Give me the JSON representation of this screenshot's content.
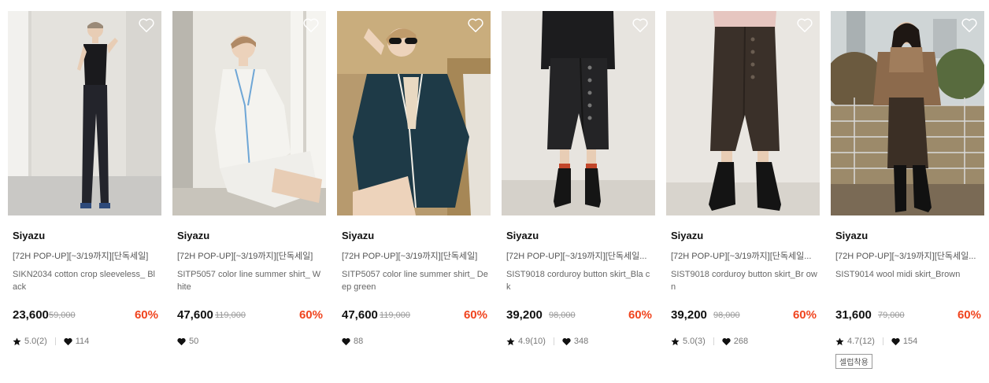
{
  "products": [
    {
      "brand": "Siyazu",
      "tagline": "[72H POP-UP][~3/19까지][단독세일]",
      "name": "SIKN2034 cotton crop sleeveless_ Black",
      "price": "23,600",
      "original_price": "59,000",
      "discount": "60%",
      "rating": "5.0(2)",
      "likes": "114",
      "photo_scene": "woman in black sleeveless top and trousers against white wall"
    },
    {
      "brand": "Siyazu",
      "tagline": "[72H POP-UP][~3/19까지][단독세일]",
      "name": "SITP5057 color line summer shirt_ White",
      "price": "47,600",
      "original_price": "119,000",
      "discount": "60%",
      "rating": "",
      "likes": "50",
      "photo_scene": "woman in white piped shirt seated by window"
    },
    {
      "brand": "Siyazu",
      "tagline": "[72H POP-UP][~3/19까지][단독세일]",
      "name": "SITP5057 color line summer shirt_ Deep green",
      "price": "47,600",
      "original_price": "119,000",
      "discount": "60%",
      "rating": "",
      "likes": "88",
      "photo_scene": "woman in deep green piped shirt with sunglasses outdoors"
    },
    {
      "brand": "Siyazu",
      "tagline": "[72H POP-UP][~3/19까지][단독세일...",
      "name": "SIST9018 corduroy button skirt_Bla ck",
      "price": "39,200",
      "original_price": "98,000",
      "discount": "60%",
      "rating": "4.9(10)",
      "likes": "348",
      "photo_scene": "black corduroy button skirt with black boots"
    },
    {
      "brand": "Siyazu",
      "tagline": "[72H POP-UP][~3/19까지][단독세일...",
      "name": "SIST9018 corduroy button skirt_Br own",
      "price": "39,200",
      "original_price": "98,000",
      "discount": "60%",
      "rating": "5.0(3)",
      "likes": "268",
      "photo_scene": "brown corduroy button skirt with black boots"
    },
    {
      "brand": "Siyazu",
      "tagline": "[72H POP-UP][~3/19까지][단독세일...",
      "name": "SIST9014 wool midi skirt_Brown",
      "price": "31,600",
      "original_price": "79,000",
      "discount": "60%",
      "rating": "4.7(12)",
      "likes": "154",
      "badge": "셀럽착용",
      "photo_scene": "woman in brown wool midi skirt on rooftop terrace"
    }
  ],
  "colors": {
    "discount": "#f0441e",
    "text": "#222222",
    "muted": "#777777"
  },
  "icons": {
    "wishlist": "heart-outline-icon",
    "rating": "star-icon",
    "likes": "heart-filled-icon"
  }
}
